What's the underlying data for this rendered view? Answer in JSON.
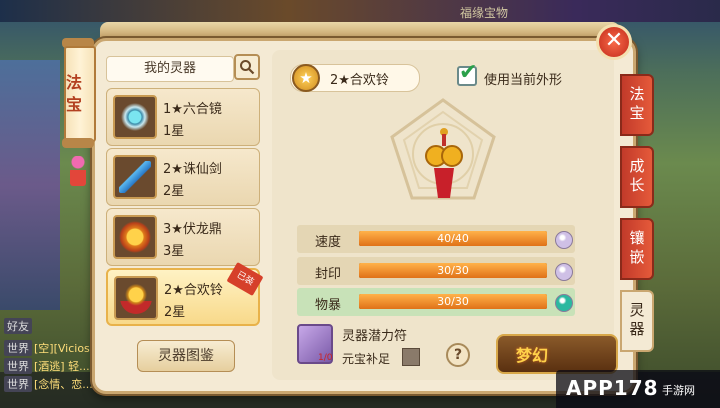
{
  "bg_title": "福缘宝物",
  "chat": [
    {
      "tag": "好友",
      "text": ""
    },
    {
      "tag": "世界",
      "text": "[空][Vicios..."
    },
    {
      "tag": "世界",
      "text": "[酒逃] 轻..."
    },
    {
      "tag": "世界",
      "text": "[念情、恋..."
    }
  ],
  "left_tab": {
    "label": "法宝"
  },
  "list": {
    "title": "我的灵器",
    "items": [
      {
        "name": "1★六合镜",
        "stars": "1星",
        "selected": false
      },
      {
        "name": "2★诛仙剑",
        "stars": "2星",
        "selected": false
      },
      {
        "name": "3★伏龙鼎",
        "stars": "3星",
        "selected": false
      },
      {
        "name": "2★合欢铃",
        "stars": "2星",
        "selected": true,
        "badge": "已装"
      }
    ],
    "catalog_button": "灵器图鉴"
  },
  "detail": {
    "name": "2★合欢铃",
    "star_glyph": "★",
    "use_current_look": "使用当前外形",
    "stats": [
      {
        "label": "速度",
        "value": "40/40",
        "fraction": 1.0,
        "dot_color": "#cfc0e6",
        "highlight": false
      },
      {
        "label": "封印",
        "value": "30/30",
        "fraction": 1.0,
        "dot_color": "#cfc0e6",
        "highlight": false
      },
      {
        "label": "物暴",
        "value": "30/30",
        "fraction": 1.0,
        "dot_color": "#2ab8a0",
        "highlight": true
      }
    ],
    "charm": {
      "name": "灵器潜力符",
      "count": "1/0"
    },
    "auto_fill": "元宝补足",
    "help": "?",
    "refine_logo": "梦幻"
  },
  "side_tabs": [
    {
      "label": "法宝",
      "active": false
    },
    {
      "label": "成长",
      "active": false
    },
    {
      "label": "镶嵌",
      "active": false
    },
    {
      "label": "灵器",
      "active": true
    }
  ],
  "close_glyph": "✕",
  "watermark": {
    "main": "APP178",
    "sub": "手游网"
  }
}
